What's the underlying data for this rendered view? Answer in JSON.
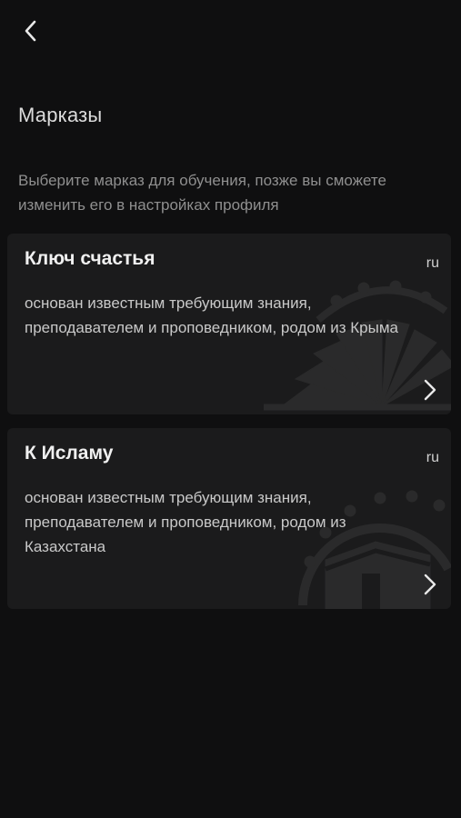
{
  "header": {
    "back_icon": "chevron-left-icon"
  },
  "page": {
    "title": "Марказы",
    "subtitle": "Выберите марказ для обучения, позже вы сможете изменить его в настройках профиля"
  },
  "markaz_cards": [
    {
      "title": "Ключ счастья",
      "lang": "ru",
      "description": "основан известным требующим знания, преподавателем и проповедником, родом из Крыма",
      "art_icon": "open-book-icon"
    },
    {
      "title": "К Исламу",
      "lang": "ru",
      "description": "основан известным требующим знания, преподавателем и проповедником, родом из Казахстана",
      "art_icon": "kaaba-people-circle-icon"
    }
  ],
  "colors": {
    "background": "#0f0f10",
    "card": "#1b1b1c",
    "title_text": "#f0f0f0",
    "secondary_text": "#8f8f8f"
  }
}
